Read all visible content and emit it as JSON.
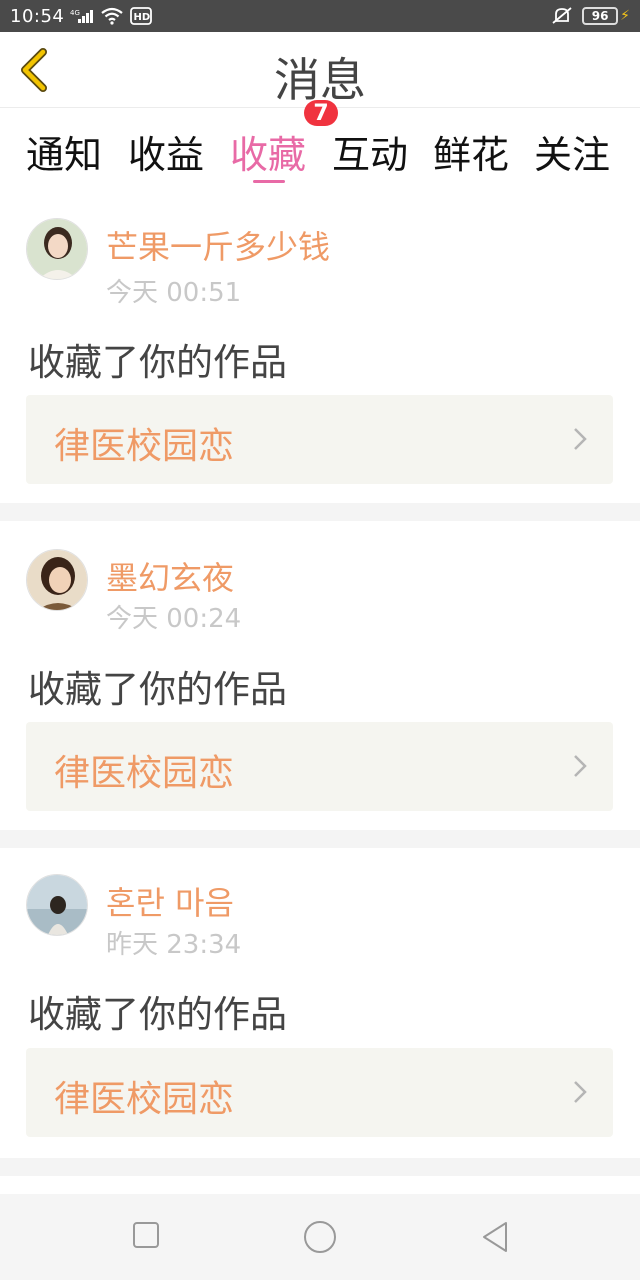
{
  "status": {
    "time": "10:54",
    "network": "4G",
    "hd": "HD",
    "battery": "96"
  },
  "header": {
    "title": "消息",
    "back_icon": "chevron-left-icon"
  },
  "tabs": [
    {
      "label": "通知"
    },
    {
      "label": "收益"
    },
    {
      "label": "收藏",
      "active": true,
      "badge": "7"
    },
    {
      "label": "互动"
    },
    {
      "label": "鲜花"
    },
    {
      "label": "关注"
    }
  ],
  "messages": [
    {
      "user": "芒果一斤多少钱",
      "time": "今天 00:51",
      "action": "收藏了你的作品",
      "work": "律医校园恋"
    },
    {
      "user": "墨幻玄夜",
      "time": "今天 00:24",
      "action": "收藏了你的作品",
      "work": "律医校园恋"
    },
    {
      "user": "혼란 마음",
      "time": "昨天 23:34",
      "action": "收藏了你的作品",
      "work": "律医校园恋"
    }
  ],
  "colors": {
    "accent": "#e86aa6",
    "username": "#ef9a66",
    "badge": "#f0333f",
    "back_arrow": "#f2c400"
  }
}
